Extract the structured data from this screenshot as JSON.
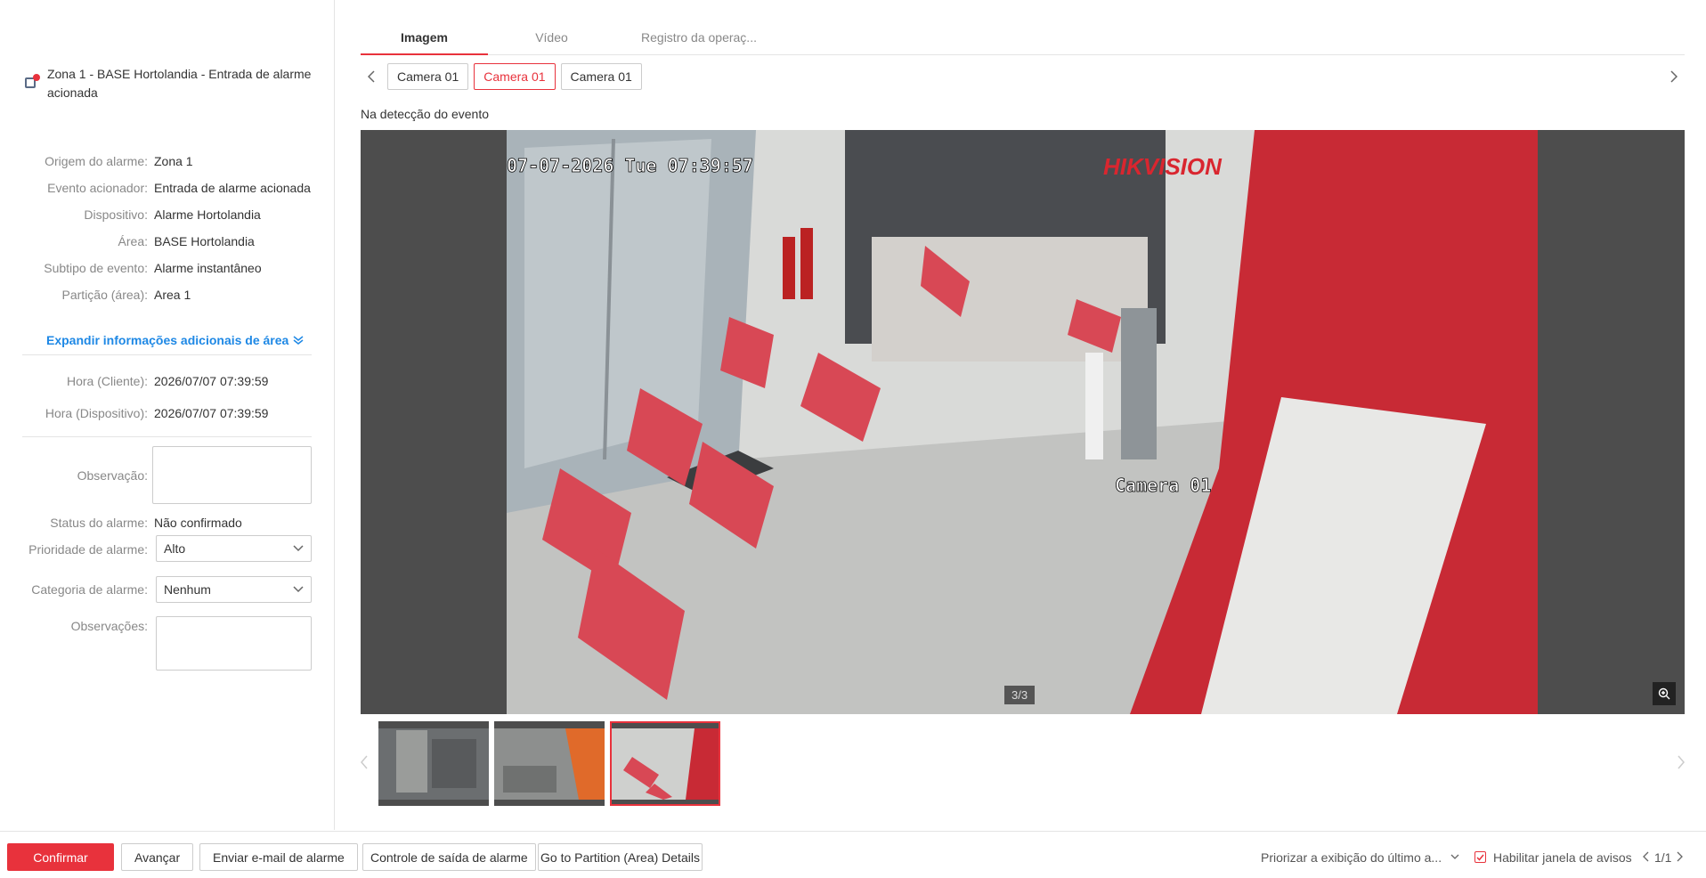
{
  "alarm": {
    "title": "Zona 1 - BASE Hortolandia - Entrada de alarme acionada",
    "icon": "alarm-device-icon"
  },
  "details": [
    {
      "label": "Origem do alarme:",
      "value": "Zona 1"
    },
    {
      "label": "Evento acionador:",
      "value": "Entrada de alarme acionada"
    },
    {
      "label": "Dispositivo:",
      "value": "Alarme Hortolandia"
    },
    {
      "label": "Área:",
      "value": "BASE Hortolandia"
    },
    {
      "label": "Subtipo de evento:",
      "value": "Alarme instantâneo"
    },
    {
      "label": "Partição (área):",
      "value": "Area 1"
    }
  ],
  "expand_label": "Expandir informações adicionais de área",
  "times": [
    {
      "label": "Hora (Cliente):",
      "value": "2026/07/07 07:39:59"
    },
    {
      "label": "Hora (Dispositivo):",
      "value": "2026/07/07 07:39:59"
    }
  ],
  "form": {
    "observation_label": "Observação:",
    "status_label": "Status do alarme:",
    "status_value": "Não confirmado",
    "priority_label": "Prioridade de alarme:",
    "priority_value": "Alto",
    "category_label": "Categoria de alarme:",
    "category_value": "Nenhum",
    "remarks_label": "Observações:"
  },
  "tabs": [
    "Imagem",
    "Vídeo",
    "Registro da operaç..."
  ],
  "active_tab": 0,
  "cameras": [
    "Camera 01",
    "Camera 01",
    "Camera 01"
  ],
  "active_camera": 1,
  "event_label": "Na detecção do evento",
  "image": {
    "osd_timestamp": "07-07-2026 Tue 07:39:57",
    "brand_watermark": "HIKVISION",
    "osd_camera": "Camera 01",
    "counter": "3/3"
  },
  "thumbnails": {
    "count": 3,
    "selected": 2
  },
  "footer": {
    "confirm": "Confirmar",
    "advance": "Avançar",
    "email": "Enviar e-mail de alarme",
    "output": "Controle de saída de alarme",
    "partition": "Go to Partition (Area) Details",
    "priority_display": "Priorizar a exibição do último a...",
    "enable_popup": "Habilitar janela de avisos",
    "page": "1/1"
  },
  "colors": {
    "accent": "#e8323c",
    "link": "#1e88e5"
  }
}
